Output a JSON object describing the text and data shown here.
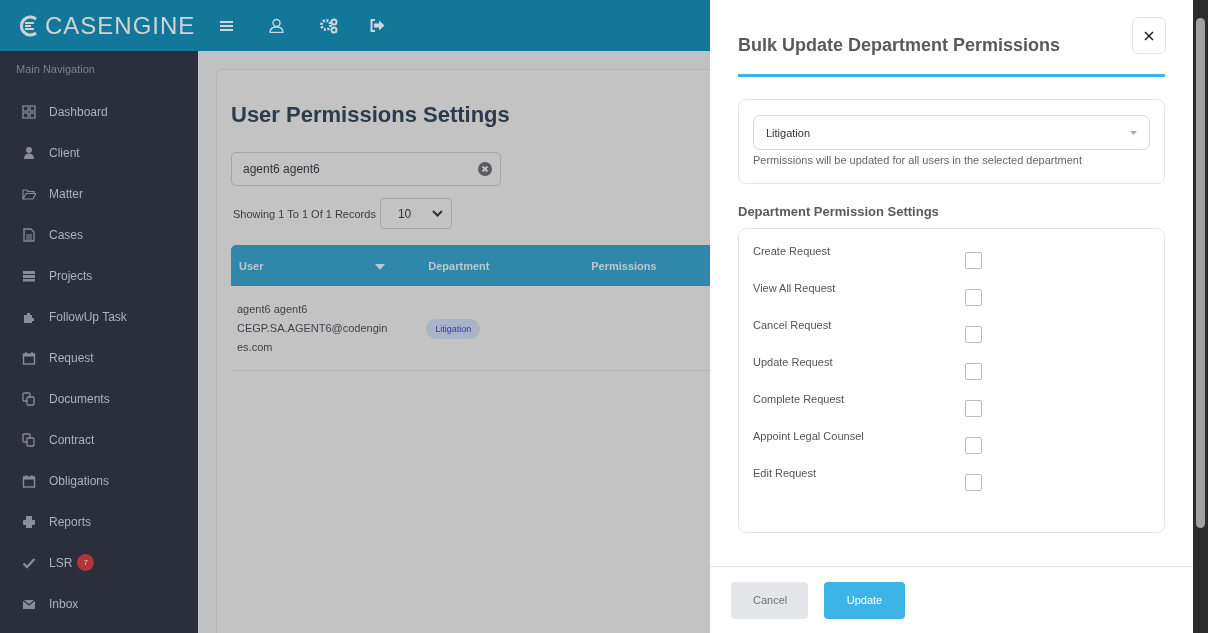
{
  "header": {
    "logo": "CASENGINE"
  },
  "sidebar": {
    "heading": "Main Navigation",
    "items": [
      {
        "label": "Dashboard"
      },
      {
        "label": "Client"
      },
      {
        "label": "Matter"
      },
      {
        "label": "Cases"
      },
      {
        "label": "Projects"
      },
      {
        "label": "FollowUp Task"
      },
      {
        "label": "Request"
      },
      {
        "label": "Documents"
      },
      {
        "label": "Contract"
      },
      {
        "label": "Obligations"
      },
      {
        "label": "Reports"
      },
      {
        "label": "LSR",
        "badge": "7"
      },
      {
        "label": "Inbox"
      }
    ]
  },
  "page": {
    "title": "User Permissions Settings",
    "search": {
      "value": "agent6 agent6"
    },
    "records": "Showing 1 To 1 Of 1 Records",
    "page_size": "10",
    "table": {
      "columns": [
        "User",
        "Department",
        "Permissions"
      ],
      "rows": [
        {
          "user": "agent6 agent6",
          "email": "CEGP.SA.AGENT6@codengines.com",
          "department": "Litigation"
        }
      ]
    }
  },
  "drawer": {
    "title": "Bulk Update Department Permissions",
    "department": {
      "value": "Litigation"
    },
    "hint": "Permissions will be updated for all users in the selected department",
    "section_title": "Department Permission Settings",
    "permissions": [
      {
        "label": "Create Request",
        "checked": false
      },
      {
        "label": "View All Request",
        "checked": false
      },
      {
        "label": "Cancel Request",
        "checked": false
      },
      {
        "label": "Update Request",
        "checked": false
      },
      {
        "label": "Complete Request",
        "checked": false
      },
      {
        "label": "Appoint Legal Counsel",
        "checked": false
      },
      {
        "label": "Edit Request",
        "checked": false
      }
    ],
    "buttons": [
      {
        "label": "Cancel",
        "kind": "secondary"
      },
      {
        "label": "Update",
        "kind": "primary"
      }
    ]
  }
}
